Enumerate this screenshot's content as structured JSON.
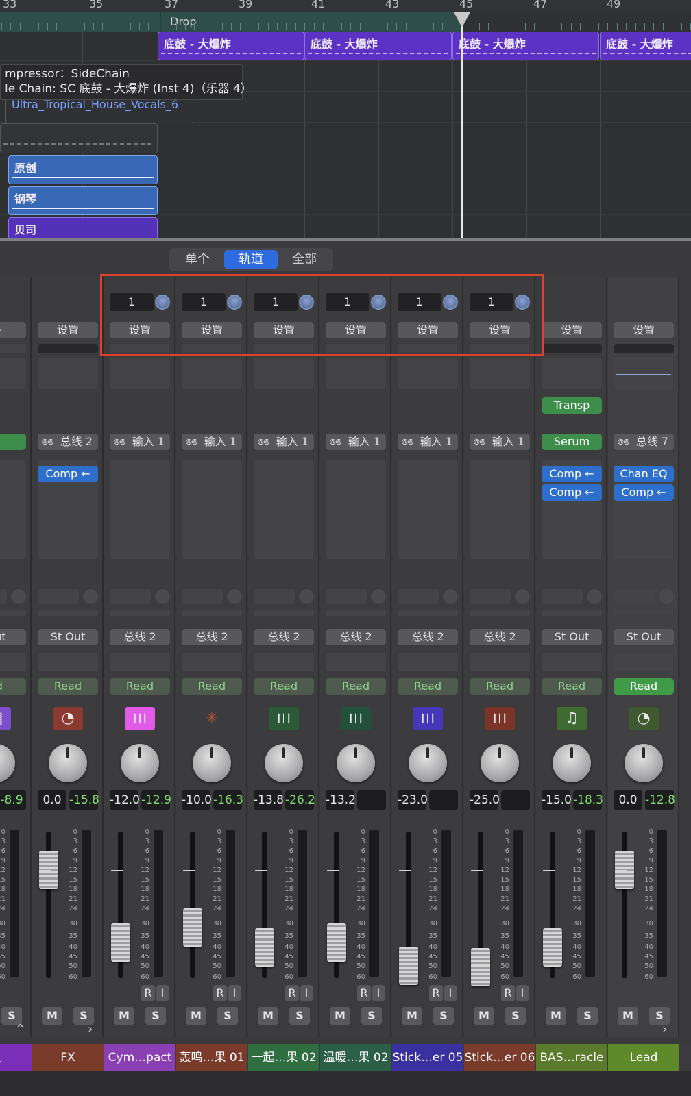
{
  "ruler": {
    "bars": [
      "33",
      "35",
      "37",
      "39",
      "41",
      "43",
      "45",
      "47",
      "49"
    ]
  },
  "marker": {
    "label": "Drop"
  },
  "regions": {
    "drums_label": "底鼓 - 大爆炸",
    "vocal_label": "Ultra_Tropical_House_Vocals_6",
    "original_label": "原创",
    "piano_label": "钢琴",
    "bass_label": "贝司"
  },
  "tooltip": {
    "line1": "mpressor：SideChain",
    "line2": "le Chain: SC 底鼓 - 大爆炸 (Inst 4)（乐器 4）"
  },
  "view_tabs": [
    {
      "label": "单个",
      "active": false
    },
    {
      "label": "轨道",
      "active": true
    },
    {
      "label": "全部",
      "active": false
    }
  ],
  "strips": [
    {
      "name": "机",
      "name_color": "#7b2fb8",
      "setting": "件",
      "sends_number": "",
      "io_in": "D",
      "io_in_type": "green",
      "plugins": [],
      "output": "Out",
      "automation": "ad",
      "automation_on": false,
      "icon": "midi-icon",
      "icon_color": "#7c4ec9",
      "volume": "",
      "peak": "-8.9",
      "ri": false
    },
    {
      "name": "FX",
      "name_color": "#7a3b2a",
      "setting": "设置",
      "sends_number": "",
      "io_in": "总线 2",
      "io_in_type": "link",
      "plugins": [
        "Comp ←"
      ],
      "output": "St Out",
      "automation": "Read",
      "automation_on": false,
      "icon": "timer-icon",
      "icon_color": "#8a3a30",
      "volume": "0.0",
      "peak": "-15.8",
      "ri": false
    },
    {
      "name": "Cym…pact",
      "name_color": "#8a3fb3",
      "setting": "设置",
      "sends_number": "1",
      "io_in": "输入 1",
      "io_in_type": "link",
      "plugins": [],
      "output": "总线 2",
      "automation": "Read",
      "automation_on": false,
      "icon": "waveform-icon",
      "icon_color": "#e25ae8",
      "volume": "-12.0",
      "peak": "-12.9",
      "ri": true
    },
    {
      "name": "轰鸣…果 01",
      "name_color": "#7a3b2a",
      "setting": "设置",
      "sends_number": "1",
      "io_in": "输入 1",
      "io_in_type": "link",
      "plugins": [],
      "output": "总线 2",
      "automation": "Read",
      "automation_on": false,
      "icon": "burst-icon",
      "icon_color": "#3c3c3e",
      "volume": "-10.0",
      "peak": "-16.3",
      "ri": true
    },
    {
      "name": "一起…果 02",
      "name_color": "#2e6e40",
      "setting": "设置",
      "sends_number": "1",
      "io_in": "输入 1",
      "io_in_type": "link",
      "plugins": [],
      "output": "总线 2",
      "automation": "Read",
      "automation_on": false,
      "icon": "waveform-icon",
      "icon_color": "#2c5a38",
      "volume": "-13.8",
      "peak": "-26.2",
      "ri": true
    },
    {
      "name": "温暖…果 02",
      "name_color": "#2c5f48",
      "setting": "设置",
      "sends_number": "1",
      "io_in": "输入 1",
      "io_in_type": "link",
      "plugins": [],
      "output": "总线 2",
      "automation": "Read",
      "automation_on": false,
      "icon": "waveform-icon",
      "icon_color": "#24503e",
      "volume": "-13.2",
      "peak": "",
      "ri": true
    },
    {
      "name": "Stick…er 05",
      "name_color": "#3a31a0",
      "setting": "设置",
      "sends_number": "1",
      "io_in": "输入 1",
      "io_in_type": "link",
      "plugins": [],
      "output": "总线 2",
      "automation": "Read",
      "automation_on": false,
      "icon": "waveform-icon",
      "icon_color": "#4636b8",
      "volume": "-23.0",
      "peak": "",
      "ri": true
    },
    {
      "name": "Stick…er 06",
      "name_color": "#7a3b2a",
      "setting": "设置",
      "sends_number": "1",
      "io_in": "输入 1",
      "io_in_type": "link",
      "plugins": [],
      "output": "总线 2",
      "automation": "Read",
      "automation_on": false,
      "icon": "waveform-icon",
      "icon_color": "#7c3428",
      "volume": "-25.0",
      "peak": "",
      "ri": true
    },
    {
      "name": "BAS…racle",
      "name_color": "#5a7a2c",
      "setting": "设置",
      "sends_number": "",
      "io_in": "Serum",
      "io_in_type": "green",
      "plugins": [
        "Comp ←",
        "Comp ←"
      ],
      "midi_fx": "Transp",
      "output": "St Out",
      "automation": "Read",
      "automation_on": false,
      "icon": "note-icon",
      "icon_color": "#3f6a32",
      "volume": "-15.0",
      "peak": "-18.3",
      "ri": false
    },
    {
      "name": "Lead",
      "name_color": "#5f8a2a",
      "setting": "设置",
      "sends_number": "",
      "io_in": "总线 7",
      "io_in_type": "link",
      "plugins": [
        "Chan EQ",
        "Comp ←"
      ],
      "output": "St Out",
      "automation": "Read",
      "automation_on": true,
      "icon": "timer-icon",
      "icon_color": "#3f5a30",
      "volume": "0.0",
      "peak": "-12.8",
      "ri": false
    }
  ],
  "fader_levels_db": [
    0,
    -6,
    -30,
    -24,
    -32,
    -30,
    -40,
    -41,
    -32,
    -6
  ],
  "fader_scale": [
    "0",
    "3",
    "6",
    "9",
    "12",
    "15",
    "18",
    "21",
    "24",
    "30",
    "35",
    "40",
    "45",
    "50",
    "60"
  ],
  "buttons": {
    "mute": "M",
    "solo": "S",
    "read_input": "R",
    "input_monitor": "I"
  },
  "colors": {
    "accent": "#2e6be0",
    "highlight": "#e0412f",
    "read_on": "#3f9b48"
  }
}
